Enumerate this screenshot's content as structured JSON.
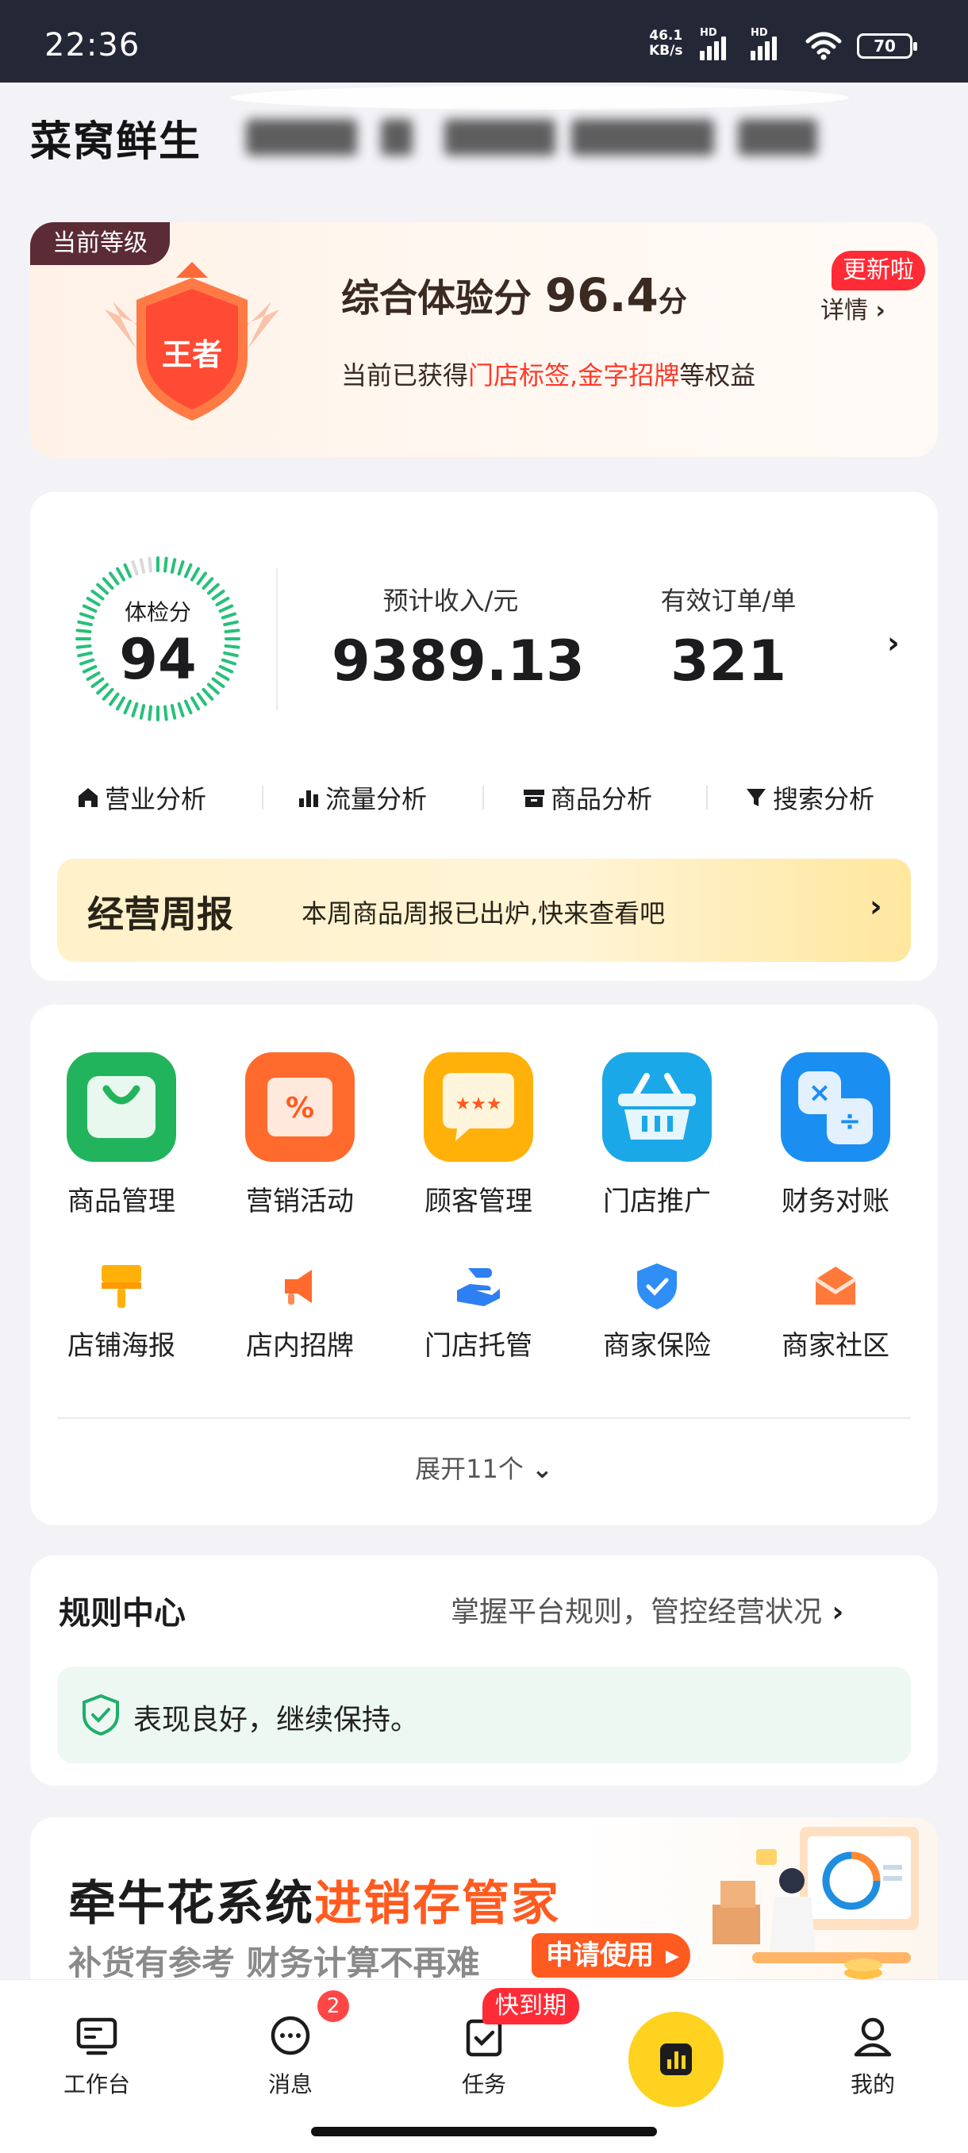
{
  "status_bar": {
    "time": "22:36",
    "net_speed_value": "46.1",
    "net_speed_unit": "KB/s",
    "hd_label": "HD",
    "battery": "70"
  },
  "header": {
    "store_name": "菜窝鲜生"
  },
  "level_card": {
    "tag": "当前等级",
    "badge_text": "王者",
    "score_prefix": "综合体验分",
    "score_value": "96.4",
    "score_unit": "分",
    "detail_link": "详情",
    "update_badge": "更新啦",
    "rights_prefix": "当前已获得",
    "right_1": "门店标签",
    "sep": ",",
    "right_2": "金字招牌",
    "rights_suffix": "等权益"
  },
  "stats": {
    "health_label": "体检分",
    "health_score": "94",
    "health_level": 0.94,
    "revenue_label": "预计收入/元",
    "revenue_value": "9389.13",
    "orders_label": "有效订单/单",
    "orders_value": "321",
    "tabs": [
      {
        "label": "营业分析",
        "icon": "home-icon"
      },
      {
        "label": "流量分析",
        "icon": "bar-chart-icon"
      },
      {
        "label": "商品分析",
        "icon": "box-icon"
      },
      {
        "label": "搜索分析",
        "icon": "filter-icon"
      }
    ],
    "weekly": {
      "title": "经营周报",
      "desc": "本周商品周报已出炉,快来查看吧"
    }
  },
  "tools": {
    "row1": [
      {
        "label": "商品管理",
        "icon": "shopping-bag-icon"
      },
      {
        "label": "营销活动",
        "icon": "coupon-icon"
      },
      {
        "label": "顾客管理",
        "icon": "chat-rating-icon"
      },
      {
        "label": "门店推广",
        "icon": "basket-icon"
      },
      {
        "label": "财务对账",
        "icon": "calculator-icon"
      }
    ],
    "row2": [
      {
        "label": "店铺海报",
        "icon": "brush-icon"
      },
      {
        "label": "店内招牌",
        "icon": "megaphone-icon"
      },
      {
        "label": "门店托管",
        "icon": "hand-icon"
      },
      {
        "label": "商家保险",
        "icon": "shield-check-icon"
      },
      {
        "label": "商家社区",
        "icon": "mail-icon"
      }
    ],
    "expand": "展开11个"
  },
  "rules": {
    "title": "规则中心",
    "subtitle": "掌握平台规则，管控经营状况",
    "status": "表现良好，继续保持。"
  },
  "promo": {
    "title_a": "牵牛花系统",
    "title_b": "进销存管家",
    "subtitle": "补货有参考 财务计算不再难",
    "button": "申请使用"
  },
  "bottom_nav": {
    "items": [
      {
        "label": "工作台",
        "icon": "workbench-icon"
      },
      {
        "label": "消息",
        "icon": "message-icon"
      },
      {
        "label": "任务",
        "icon": "task-icon"
      },
      {
        "label": "",
        "icon": "chart-center-icon"
      },
      {
        "label": "我的",
        "icon": "profile-icon"
      }
    ],
    "message_badge": "2",
    "task_badge": "快到期"
  },
  "colors": {
    "accent_red": "#ff2b36",
    "accent_orange": "#ff5a1f",
    "ring_green": "#27c07a",
    "center_yellow": "#ffd21f"
  }
}
